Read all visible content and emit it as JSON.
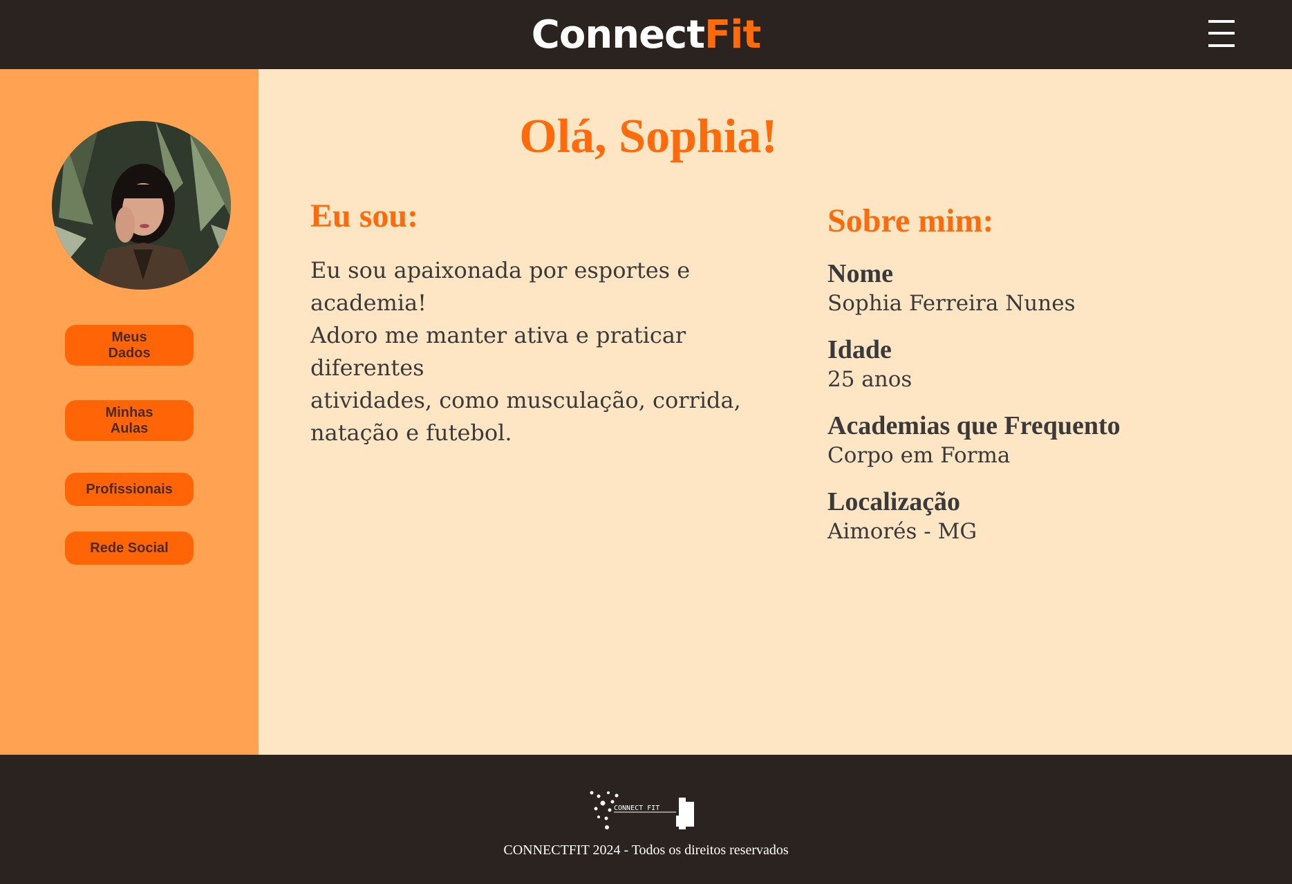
{
  "header": {
    "brand_part1": "Connect",
    "brand_part2": "Fit",
    "menu_icon": "hamburger-menu-icon"
  },
  "colors": {
    "accent": "#ff6a0a",
    "dark": "#2b2320",
    "sidebar": "#ffa252",
    "background": "#fee5c4",
    "button": "#ff6507"
  },
  "sidebar": {
    "avatar_icon": "profile-photo",
    "buttons": [
      {
        "label": "Meus\nDados"
      },
      {
        "label": "Minhas\nAulas"
      },
      {
        "label": "Profissionais"
      },
      {
        "label": "Rede Social"
      }
    ]
  },
  "main": {
    "greeting": "Olá, Sophia!",
    "about": {
      "title": "Eu sou:",
      "text": "Eu sou apaixonada por esportes e\nacademia!\nAdoro me manter ativa e praticar diferentes\natividades, como musculação, corrida,\nnatação e futebol."
    },
    "info": {
      "title": "Sobre mim:",
      "fields": [
        {
          "label": "Nome",
          "value": "Sophia Ferreira Nunes"
        },
        {
          "label": "Idade",
          "value": "25 anos"
        },
        {
          "label": "Academias que Frequento",
          "value": "Corpo em Forma"
        },
        {
          "label": "Localização",
          "value": "Aimorés - MG"
        }
      ]
    }
  },
  "footer": {
    "logo_text": "CONNECT FIT",
    "copyright": "CONNECTFIT 2024 - Todos os direitos reservados"
  }
}
